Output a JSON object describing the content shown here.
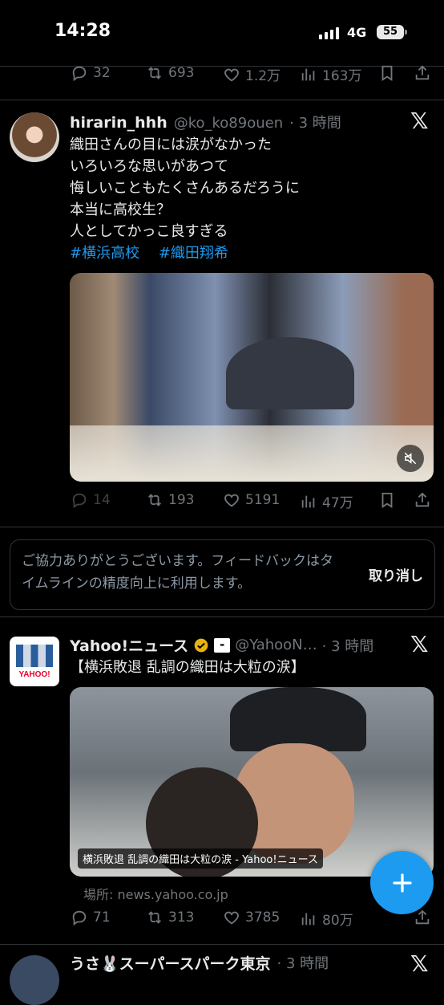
{
  "status_bar": {
    "time": "14:28",
    "network": "4G",
    "battery": "55"
  },
  "tweet0_actions": {
    "replies": "32",
    "retweets": "693",
    "likes": "1.2万",
    "views": "163万"
  },
  "tweet1": {
    "name": "hirarin_hhh",
    "handle": "@ko_ko89ouen",
    "time": "· 3 時間",
    "lines": [
      "織田さんの目には涙がなかった",
      "いろいろな思いがあつて",
      "悔しいこともたくさんあるだろうに",
      "本当に高校生？",
      "人としてかっこ良すぎる"
    ],
    "hashtags": [
      "#横浜高校",
      "#織田翔希"
    ],
    "actions": {
      "replies": "14",
      "retweets": "193",
      "likes": "5191",
      "views": "47万"
    }
  },
  "feedback": {
    "text": "ご協力ありがとうございます。フィードバックはタイムラインの精度向上に利用します。",
    "undo": "取り消し"
  },
  "tweet2": {
    "name": "Yahoo!ニュース",
    "handle": "@YahooN…",
    "time": "· 3 時間",
    "title": "【横浜敗退 乱調の織田は大粒の涙】",
    "card_caption": "横浜敗退 乱調の織田は大粒の涙 - Yahoo!ニュース",
    "domain": "場所: news.yahoo.co.jp",
    "logo_text": "YAHOO!",
    "actions": {
      "replies": "71",
      "retweets": "313",
      "likes": "3785",
      "views": "80万"
    }
  },
  "tweet3": {
    "name": "うさ🐰スーパースパーク東京",
    "time": "· 3 時間"
  },
  "colors": {
    "accent": "#1d9bf0",
    "muted": "#71767b",
    "border": "#2f3336"
  }
}
